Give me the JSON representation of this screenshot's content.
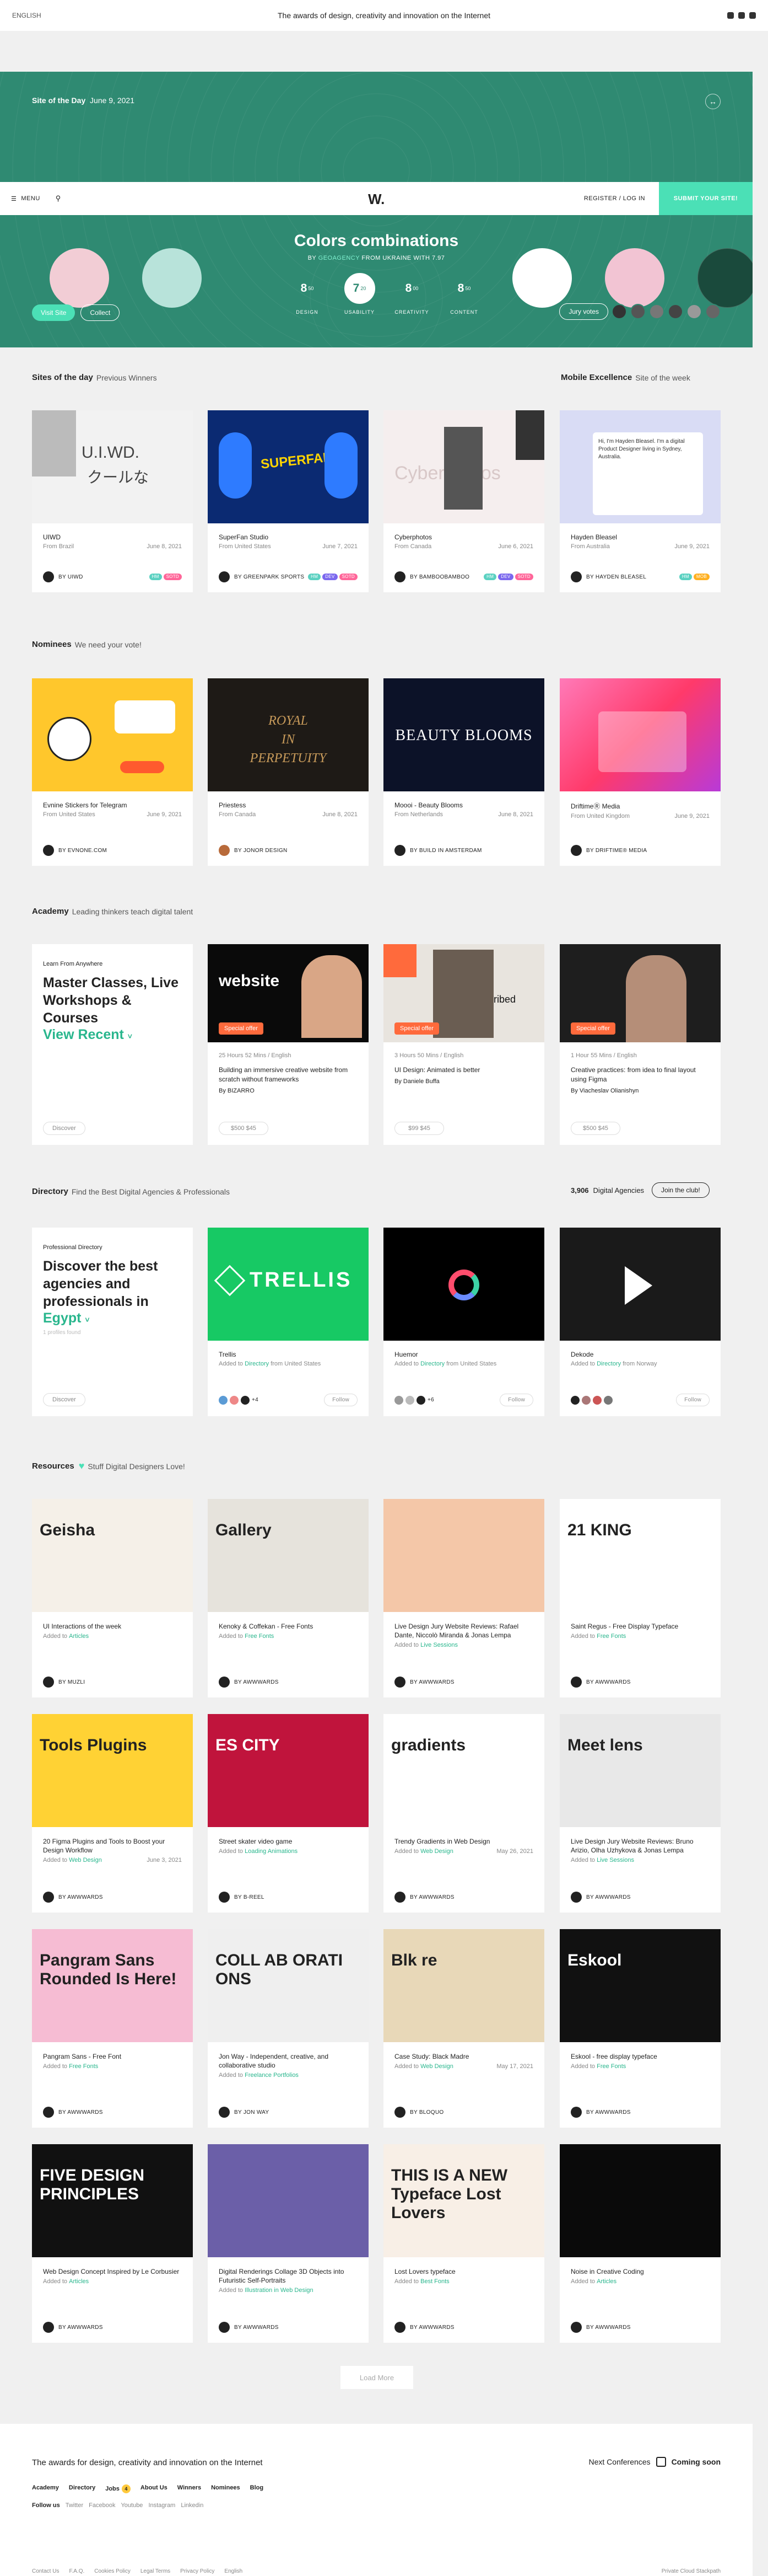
{
  "topbar": {
    "lang": "ENGLISH",
    "tagline": "The awards of design, creativity and innovation on the Internet"
  },
  "hero": {
    "sotd_label": "Site of the Day",
    "sotd_date": "June 9, 2021",
    "menu": "MENU",
    "logo": "W.",
    "register": "REGISTER / LOG IN",
    "submit": "SUBMIT YOUR SITE!",
    "title": "Colors combinations",
    "by_prefix": "BY",
    "by_agency": "GEOAGENCY",
    "by_suffix": "FROM UKRAINE WITH 7.97",
    "scores": [
      {
        "value": "8",
        "dec": "50",
        "label": "DESIGN"
      },
      {
        "value": "7",
        "dec": "20",
        "label": "USABILITY"
      },
      {
        "value": "8",
        "dec": "00",
        "label": "CREATIVITY"
      },
      {
        "value": "8",
        "dec": "50",
        "label": "CONTENT"
      }
    ],
    "visit": "Visit Site",
    "collect": "Collect",
    "jury": "Jury votes",
    "swatch_colors": [
      "#f2cdd5",
      "#b8e3da",
      "#ffffff",
      "#f2c4d3",
      "#1a4a3c"
    ]
  },
  "sotd_section": {
    "title": "Sites of the day",
    "sub": "Previous Winners",
    "me_title": "Mobile Excellence",
    "me_sub": "Site of the week",
    "cards": [
      {
        "title": "UIWD",
        "from": "From Brazil",
        "date": "June 8, 2021",
        "by": "BY UIWD",
        "tags": [
          {
            "t": "HM",
            "c": "#5ad1c1"
          },
          {
            "t": "SOTD",
            "c": "#ff6699"
          }
        ]
      },
      {
        "title": "SuperFan Studio",
        "from": "From United States",
        "date": "June 7, 2021",
        "by": "BY GREENPARK SPORTS",
        "tags": [
          {
            "t": "HM",
            "c": "#5ad1c1"
          },
          {
            "t": "DEV",
            "c": "#7b68ee"
          },
          {
            "t": "SOTD",
            "c": "#ff6699"
          }
        ]
      },
      {
        "title": "Cyberphotos",
        "from": "From Canada",
        "date": "June 6, 2021",
        "by": "BY BAMBOOBAMBOO",
        "tags": [
          {
            "t": "HM",
            "c": "#5ad1c1"
          },
          {
            "t": "DEV",
            "c": "#7b68ee"
          },
          {
            "t": "SOTD",
            "c": "#ff6699"
          }
        ]
      },
      {
        "title": "Hayden Bleasel",
        "from": "From Australia",
        "date": "June 9, 2021",
        "by": "BY HAYDEN BLEASEL",
        "tags": [
          {
            "t": "HM",
            "c": "#5ad1c1"
          },
          {
            "t": "MOB",
            "c": "#ffb020"
          }
        ]
      }
    ]
  },
  "nominees": {
    "title": "Nominees",
    "sub": "We need your vote!",
    "cards": [
      {
        "title": "Evnine Stickers for Telegram",
        "from": "From United States",
        "date": "June 9, 2021",
        "by": "BY EVNONE.COM"
      },
      {
        "title": "Priestess",
        "from": "From Canada",
        "date": "June 8, 2021",
        "by": "BY JONOR DESIGN"
      },
      {
        "title": "Moooi - Beauty Blooms",
        "from": "From Netherlands",
        "date": "June 8, 2021",
        "by": "BY BUILD IN AMSTERDAM"
      },
      {
        "title": "DriftimeⓇ Media",
        "from": "From United Kingdom",
        "date": "June 9, 2021",
        "by": "BY DRIFTIME® MEDIA"
      }
    ]
  },
  "academy": {
    "title": "Academy",
    "sub": "Leading thinkers teach digital talent",
    "intro_small": "Learn From Anywhere",
    "intro_big": "Master Classes, Live Workshops & Courses",
    "intro_link": "View Recent",
    "discover": "Discover",
    "cards": [
      {
        "meta": "25 Hours 52 Mins / English",
        "title": "Building an immersive creative website from scratch without frameworks",
        "by_prefix": "By",
        "by": "BIZARRO",
        "price": "$500 $45",
        "offer": "Special offer",
        "img_text": "website"
      },
      {
        "meta": "3 Hours 50 Mins / English",
        "title": "UI Design: Animated is better",
        "by_prefix": "By",
        "by": "Daniele Buffa",
        "price": "$99 $45",
        "offer": "Special offer",
        "img_text": "ribed"
      },
      {
        "meta": "1 Hour 55 Mins / English",
        "title": "Creative practices: from idea to final layout using Figma",
        "by_prefix": "By",
        "by": "Viacheslav Olianishyn",
        "price": "$500 $45",
        "offer": "Special offer",
        "img_text": ""
      }
    ]
  },
  "directory": {
    "title": "Directory",
    "sub": "Find the Best Digital Agencies & Professionals",
    "count": "3,906",
    "count_label": "Digital Agencies",
    "join": "Join the club!",
    "intro_small": "Professional Directory",
    "intro_big": "Discover the best agencies and professionals in",
    "intro_loc": "Egypt",
    "intro_found": "1 profiles found",
    "discover": "Discover",
    "follow": "Follow",
    "cards": [
      {
        "title": "Trellis",
        "added": "Added to",
        "link": "Directory",
        "from": "from United States",
        "logo": "TRELLIS",
        "count": "+4"
      },
      {
        "title": "Huemor",
        "added": "Added to",
        "link": "Directory",
        "from": "from United States",
        "logo": "",
        "count": "+6"
      },
      {
        "title": "Dekode",
        "added": "Added to",
        "link": "Directory",
        "from": "from Norway",
        "logo": "",
        "count": ""
      }
    ]
  },
  "resources": {
    "title": "Resources",
    "sub": "Stuff Digital Designers Love!",
    "cards": [
      {
        "title": "UI Interactions of the week",
        "added": "Added to",
        "link": "Articles",
        "date": "",
        "by": "BY MUZLI",
        "img": "Geisha",
        "bg": "#f5f0e8"
      },
      {
        "title": "Kenoky & Coffekan - Free Fonts",
        "added": "Added to",
        "link": "Free Fonts",
        "date": "",
        "by": "BY AWWWARDS",
        "img": "Gallery",
        "bg": "#e6e3dc"
      },
      {
        "title": "Live Design Jury Website Reviews: Rafael Dante, Niccolò Miranda & Jonas Lempa",
        "added": "Added to",
        "link": "Live Sessions",
        "date": "",
        "by": "BY AWWWARDS",
        "img": "",
        "bg": "#f4c7a8"
      },
      {
        "title": "Saint Regus - Free Display Typeface",
        "added": "Added to",
        "link": "Free Fonts",
        "date": "",
        "by": "BY AWWWARDS",
        "img": "21 KING",
        "bg": "#ffffff"
      },
      {
        "title": "20 Figma Plugins and Tools to Boost your Design Workflow",
        "added": "Added to",
        "link": "Web Design",
        "date": "June 3, 2021",
        "by": "BY AWWWARDS",
        "img": "Tools Plugins",
        "bg": "#ffd234"
      },
      {
        "title": "Street skater video game",
        "added": "Added to",
        "link": "Loading Animations",
        "date": "",
        "by": "BY B-REEL",
        "img": "ES CITY",
        "bg": "#c0143c"
      },
      {
        "title": "Trendy Gradients in Web Design",
        "added": "Added to",
        "link": "Web Design",
        "date": "May 26, 2021",
        "by": "BY AWWWARDS",
        "img": "gradients",
        "bg": "#ffffff"
      },
      {
        "title": "Live Design Jury Website Reviews: Bruno Arizio, Olha Uzhykova & Jonas Lempa",
        "added": "Added to",
        "link": "Live Sessions",
        "date": "",
        "by": "BY AWWWARDS",
        "img": "Meet lens",
        "bg": "#e8e8e8"
      },
      {
        "title": "Pangram Sans - Free Font",
        "added": "Added to",
        "link": "Free Fonts",
        "date": "",
        "by": "BY AWWWARDS",
        "img": "Pangram Sans Rounded Is Here!",
        "bg": "#f6bcd3"
      },
      {
        "title": "Jon Way - Independent, creative, and collaborative studio",
        "added": "Added to",
        "link": "Freelance Portfolios",
        "date": "",
        "by": "BY JON WAY",
        "img": "COLL AB ORATI ONS",
        "bg": "#efefef"
      },
      {
        "title": "Case Study: Black Madre",
        "added": "Added to",
        "link": "Web Design",
        "date": "May 17, 2021",
        "by": "BY BLOQUO",
        "img": "Blk re",
        "bg": "#e8d8b8"
      },
      {
        "title": "Eskool - free display typeface",
        "added": "Added to",
        "link": "Free Fonts",
        "date": "",
        "by": "BY AWWWARDS",
        "img": "Eskool",
        "bg": "#111111"
      },
      {
        "title": "Web Design Concept Inspired by Le Corbusier",
        "added": "Added to",
        "link": "Articles",
        "date": "",
        "by": "BY AWWWARDS",
        "img": "FIVE DESIGN PRINCIPLES",
        "bg": "#111111"
      },
      {
        "title": "Digital Renderings Collage 3D Objects into Futuristic Self-Portraits",
        "added": "Added to",
        "link": "Illustration in Web Design",
        "date": "",
        "by": "BY AWWWARDS",
        "img": "",
        "bg": "#6b5fa8"
      },
      {
        "title": "Lost Lovers typeface",
        "added": "Added to",
        "link": "Best Fonts",
        "date": "",
        "by": "BY AWWWARDS",
        "img": "THIS IS A NEW Typeface Lost Lovers",
        "bg": "#f8efe6"
      },
      {
        "title": "Noise in Creative Coding",
        "added": "Added to",
        "link": "Articles",
        "date": "",
        "by": "BY AWWWARDS",
        "img": "",
        "bg": "#0a0a0a"
      }
    ],
    "load_more": "Load More"
  },
  "footer": {
    "tagline": "The awards for design, creativity and innovation on the Internet",
    "next_conf": "Next Conferences",
    "coming": "Coming soon",
    "links": [
      "Academy",
      "Directory",
      "Jobs",
      "About Us",
      "Winners",
      "Nominees",
      "Blog"
    ],
    "jobs_badge": "4",
    "follow": "Follow us",
    "social": [
      "Twitter",
      "Facebook",
      "Youtube",
      "Instagram",
      "Linkedin"
    ],
    "bottom": [
      "Contact Us",
      "F.A.Q.",
      "Cookies Policy",
      "Legal Terms",
      "Privacy Policy",
      "English"
    ],
    "pc": "Private Cloud Stackpath"
  }
}
